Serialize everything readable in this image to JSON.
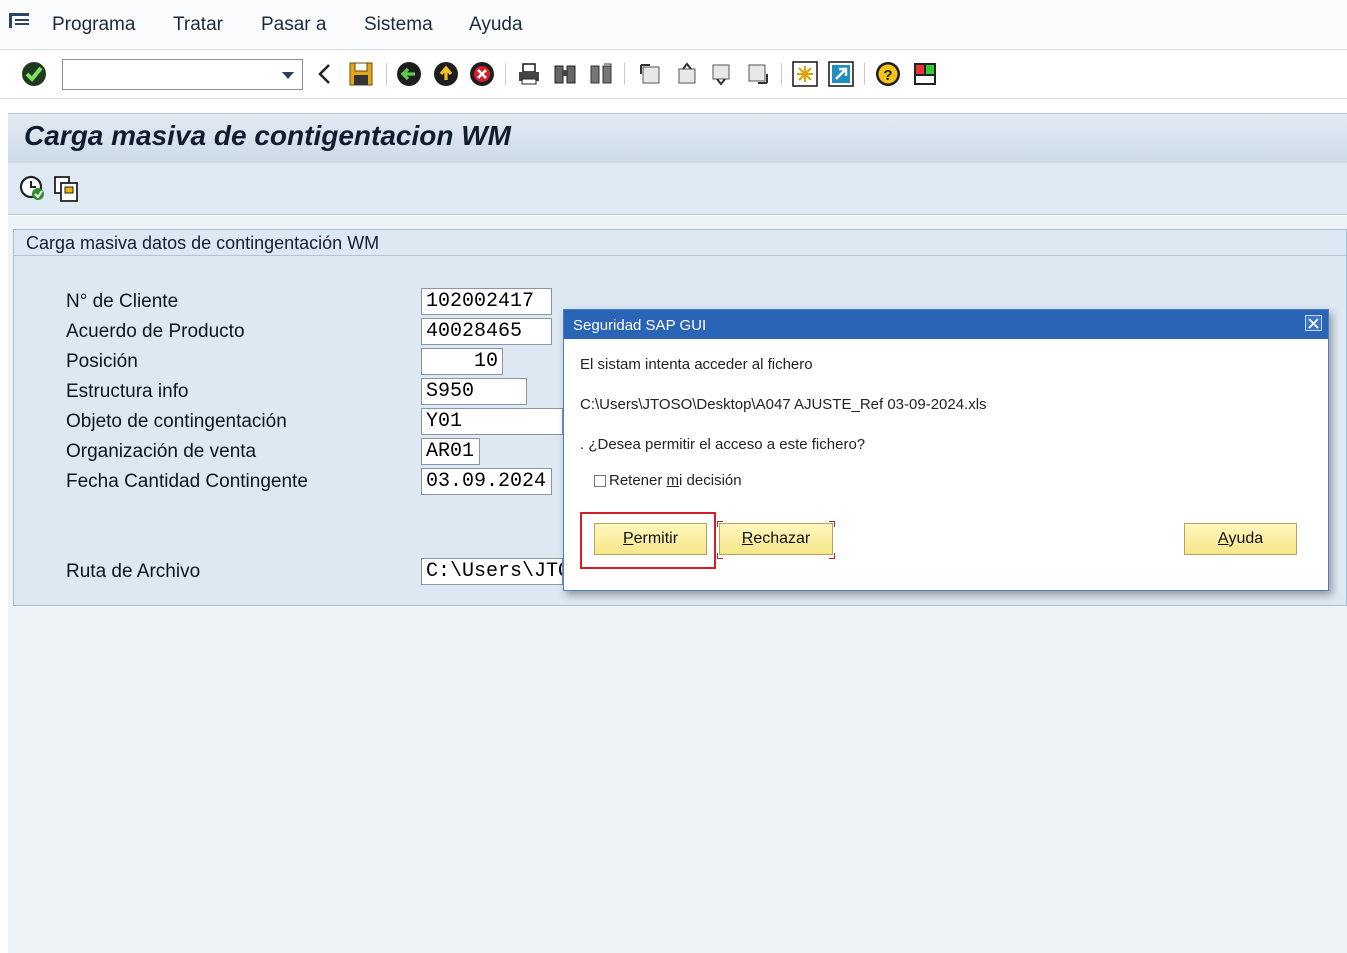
{
  "menubar": {
    "items": [
      "Programa",
      "Tratar",
      "Pasar a",
      "Sistema",
      "Ayuda"
    ]
  },
  "toolbar": {
    "command_field_value": "",
    "icons": [
      "enter-check-icon",
      "back-arrow-icon",
      "save-icon",
      "back-icon",
      "exit-icon",
      "cancel-icon",
      "print-icon",
      "find-icon",
      "find-next-icon",
      "first-page-icon",
      "previous-page-icon",
      "next-page-icon",
      "last-page-icon",
      "new-session-icon",
      "shortcut-icon",
      "help-icon",
      "layout-icon"
    ]
  },
  "page": {
    "title": "Carga masiva de contigentacion WM"
  },
  "group": {
    "title": "Carga masiva datos de contingentación WM",
    "fields": [
      {
        "label": "N° de Cliente",
        "value": "102002417"
      },
      {
        "label": "Acuerdo de Producto",
        "value": "40028465"
      },
      {
        "label": "Posición",
        "value": "10"
      },
      {
        "label": "Estructura info",
        "value": "S950"
      },
      {
        "label": "Objeto de contingentación",
        "value": "Y01"
      },
      {
        "label": "Organización de venta",
        "value": "AR01"
      },
      {
        "label": "Fecha Cantidad Contingente",
        "value": "03.09.2024"
      }
    ],
    "file_field": {
      "label": "Ruta de Archivo",
      "value": "C:\\Users\\JTOSO"
    }
  },
  "dialog": {
    "title": "Seguridad SAP GUI",
    "line1": "El sistam intenta acceder al fichero",
    "path": "C:\\Users\\JTOSO\\Desktop\\A047 AJUSTE_Ref 03-09-2024.xls",
    "question": ". ¿Desea permitir el acceso a este fichero?",
    "retain": {
      "before": "Retener ",
      "mnemonic": "m",
      "after": "i decisión",
      "checked": false
    },
    "buttons": {
      "allow": {
        "mnemonic": "P",
        "rest": "ermitir"
      },
      "deny": {
        "mnemonic": "R",
        "rest": "echazar"
      },
      "help": {
        "mnemonic": "A",
        "rest": "yuda"
      }
    }
  },
  "colors": {
    "dialog_titlebar": "#2a64b7",
    "button_fill": "#f7e78a",
    "highlight": "#d0202a",
    "panel_bg": "#dde8f2"
  }
}
